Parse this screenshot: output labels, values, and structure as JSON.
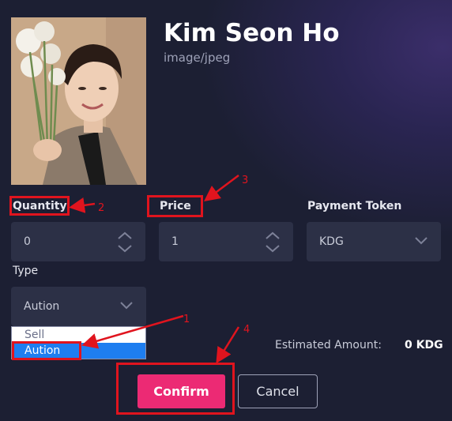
{
  "nft": {
    "title": "Kim Seon Ho",
    "mime_type": "image/jpeg"
  },
  "form": {
    "quantity_label": "Quantity",
    "quantity_value": "0",
    "price_label": "Price",
    "price_value": "1",
    "payment_token_label": "Payment Token",
    "payment_token_value": "KDG",
    "type_label": "Type",
    "type_value": "Aution",
    "type_options": [
      "Sell",
      "Aution"
    ],
    "type_selected": "Aution"
  },
  "estimated": {
    "label": "Estimated Amount:",
    "value": "0 KDG"
  },
  "actions": {
    "confirm_label": "Confirm",
    "cancel_label": "Cancel"
  },
  "annotations": {
    "n1": "1",
    "n2": "2",
    "n3": "3",
    "n4": "4"
  },
  "colors": {
    "background": "#1c1f33",
    "field": "#2c3046",
    "confirm": "#ec2a74",
    "selected_option": "#1e7ef0",
    "annotation": "#e0141e"
  }
}
